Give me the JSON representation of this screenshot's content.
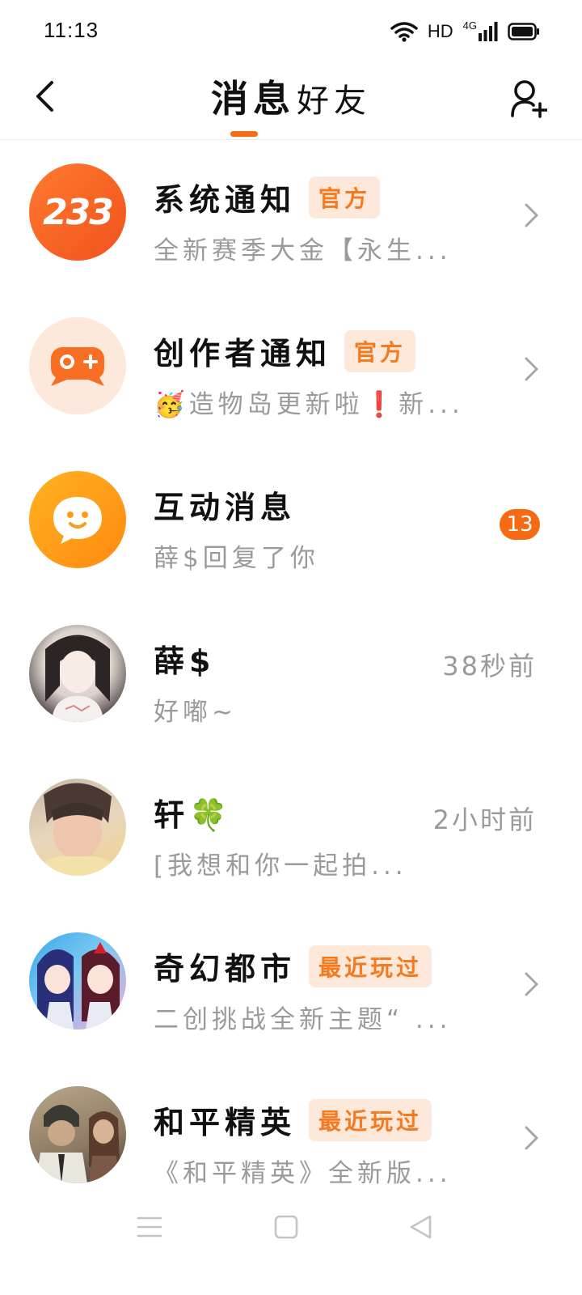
{
  "status_bar": {
    "time": "11:13",
    "hd": "HD",
    "network": "4G"
  },
  "header": {
    "tabs": [
      {
        "label": "消息",
        "active": true
      },
      {
        "label": "好友",
        "active": false
      }
    ],
    "accent_color": "#fb6b12"
  },
  "messages": [
    {
      "name": "系统通知",
      "tag": "官方",
      "preview": "全新赛季大金【永生...",
      "avatar_text": "233",
      "avatar_icon": "233-logo-icon",
      "show_chevron": true
    },
    {
      "name": "创作者通知",
      "tag": "官方",
      "preview": "🥳造物岛更新啦❗新...",
      "avatar_icon": "gamepad-icon",
      "show_chevron": true
    },
    {
      "name": "互动消息",
      "preview": "薛$回复了你",
      "avatar_icon": "chat-bubble-icon",
      "badge_count": "13"
    },
    {
      "name": "薛$",
      "preview": "好嘟~",
      "time": "38秒前",
      "avatar_icon": "user-photo"
    },
    {
      "name": "轩🍀",
      "preview": "[我想和你一起拍...",
      "time": "2小时前",
      "avatar_icon": "user-photo"
    },
    {
      "name": "奇幻都市",
      "tag": "最近玩过",
      "preview": "二创挑战全新主题“ ...",
      "avatar_icon": "game-cover",
      "show_chevron": true
    },
    {
      "name": "和平精英",
      "tag": "最近玩过",
      "preview": "《和平精英》全新版...",
      "avatar_icon": "game-cover",
      "show_chevron": true
    }
  ],
  "nav_bar": {
    "icons": [
      "menu-icon",
      "home-square-icon",
      "back-triangle-icon"
    ]
  }
}
